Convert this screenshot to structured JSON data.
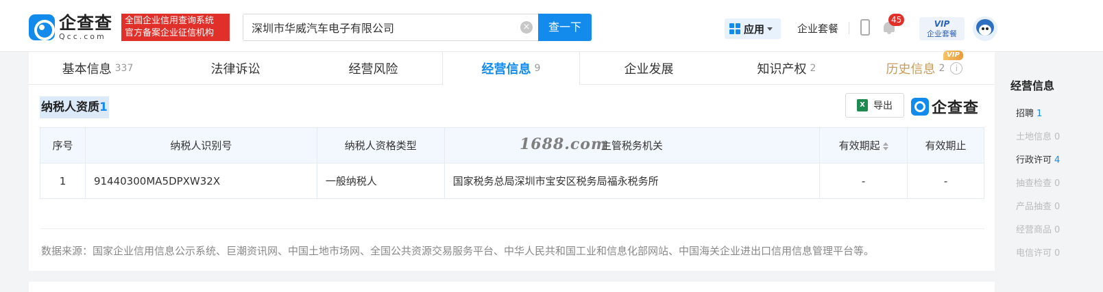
{
  "header": {
    "logo_cn": "企查查",
    "logo_en": "Qcc.com",
    "slogan_line1": "全国企业信用查询系统",
    "slogan_line2": "官方备案企业征信机构",
    "search_value": "深圳市华威汽车电子有限公司",
    "search_button": "查一下",
    "app_menu": "应用",
    "package_link": "企业套餐",
    "notification_count": "45",
    "vip_top": "VIP",
    "vip_bottom": "企业套餐"
  },
  "tabs": [
    {
      "label": "基本信息",
      "count": "337"
    },
    {
      "label": "法律诉讼",
      "count": ""
    },
    {
      "label": "经营风险",
      "count": ""
    },
    {
      "label": "经营信息",
      "count": "9"
    },
    {
      "label": "企业发展",
      "count": ""
    },
    {
      "label": "知识产权",
      "count": "2"
    },
    {
      "label": "历史信息",
      "count": "2",
      "tag": "VIP"
    }
  ],
  "section": {
    "title": "纳税人资质",
    "count": "1",
    "export_label": "导出",
    "brand": "企查查"
  },
  "table": {
    "headers": [
      "序号",
      "纳税人识别号",
      "纳税人资格类型",
      "主管税务机关",
      "有效期起",
      "有效期止"
    ],
    "rows": [
      [
        "1",
        "91440300MA5DPXW32X",
        "一般纳税人",
        "国家税务总局深圳市宝安区税务局福永税务所",
        "-",
        "-"
      ]
    ]
  },
  "watermark": "1688.com",
  "source_text": "数据来源：国家企业信用信息公示系统、巨潮资讯网、中国土地市场网、全国公共资源交易服务平台、中华人民共和国工业和信息化部网站、中国海关企业进出口信用信息管理平台等。",
  "sidebar": {
    "title": "经营信息",
    "items": [
      {
        "label": "招聘",
        "count": "1",
        "enabled": true
      },
      {
        "label": "土地信息",
        "count": "0",
        "enabled": false
      },
      {
        "label": "行政许可",
        "count": "4",
        "enabled": true
      },
      {
        "label": "抽查检查",
        "count": "0",
        "enabled": false
      },
      {
        "label": "产品抽查",
        "count": "0",
        "enabled": false
      },
      {
        "label": "经营商品",
        "count": "0",
        "enabled": false
      },
      {
        "label": "电信许可",
        "count": "0",
        "enabled": false
      }
    ]
  },
  "colors": {
    "brand_blue": "#128bed",
    "slogan_red": "#e12f29",
    "vip_gold": "#c89b5a"
  }
}
